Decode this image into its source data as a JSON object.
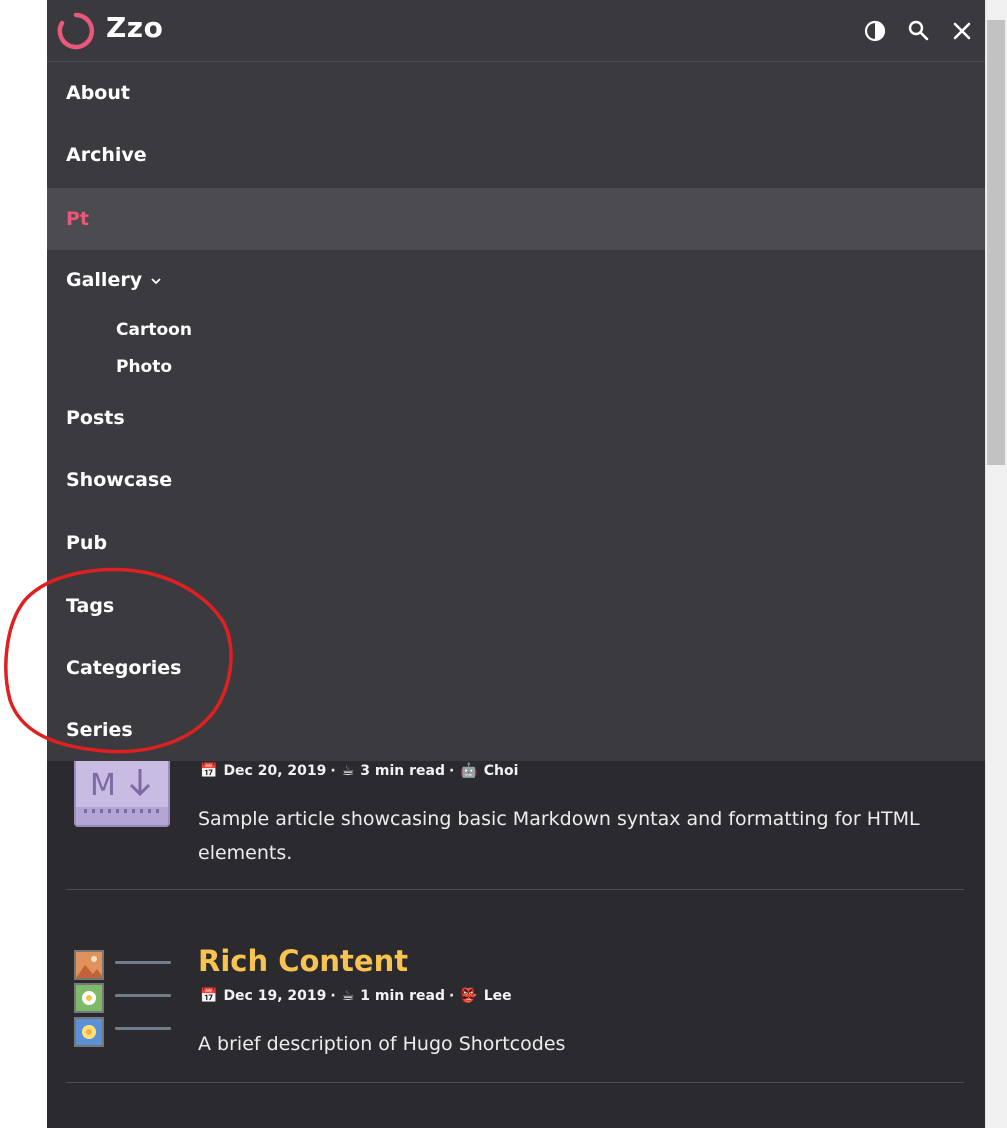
{
  "header": {
    "logo_text": "Zzo",
    "icons": [
      "theme-toggle-icon",
      "search-icon",
      "close-icon"
    ]
  },
  "menu": {
    "items": [
      {
        "label": "About"
      },
      {
        "label": "Archive"
      },
      {
        "label": "Pt",
        "active": true
      },
      {
        "label": "Gallery",
        "expanded": true,
        "children": [
          "Cartoon",
          "Photo"
        ]
      },
      {
        "label": "Posts"
      },
      {
        "label": "Showcase"
      },
      {
        "label": "Pub"
      },
      {
        "label": "Tags"
      },
      {
        "label": "Categories"
      },
      {
        "label": "Series"
      }
    ]
  },
  "posts": [
    {
      "date": "Dec 20, 2019",
      "read": "3 min read",
      "author": "Choi",
      "description": "Sample article showcasing basic Markdown syntax and formatting for HTML elements."
    },
    {
      "title": "Rich Content",
      "date": "Dec 19, 2019",
      "read": "1 min read",
      "author": "Lee",
      "description": "A brief description of Hugo Shortcodes"
    }
  ],
  "colors": {
    "background": "#2b2a2e",
    "menu": "#3b3a3e",
    "active_item": "#e8587b",
    "title": "#f8c350",
    "annotation": "#e02020"
  }
}
